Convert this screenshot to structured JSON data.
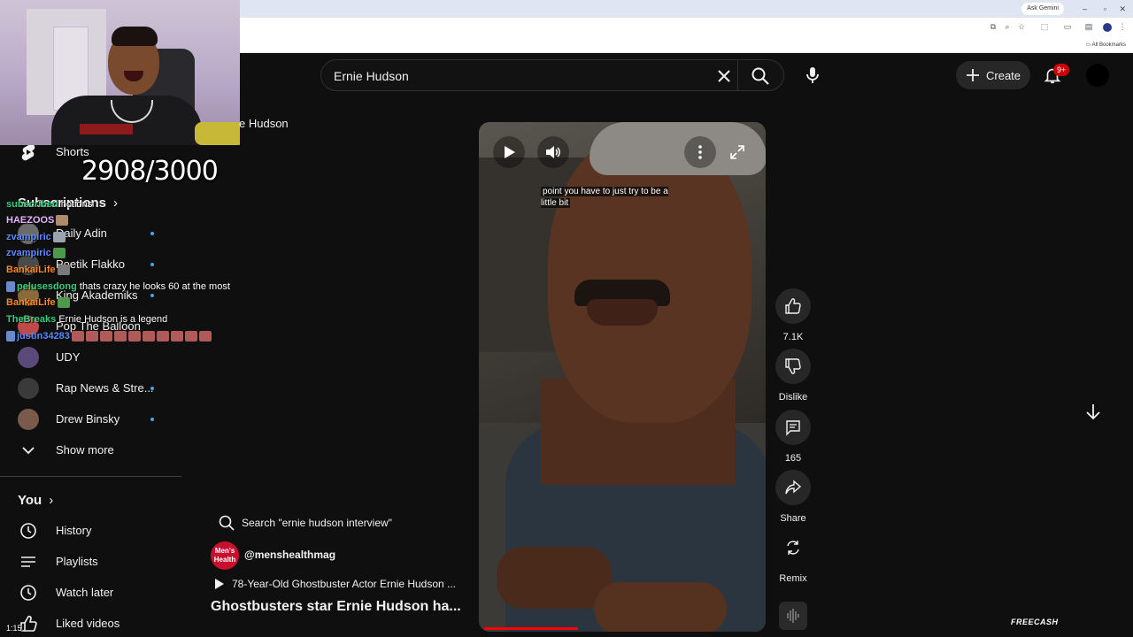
{
  "browser": {
    "gemini_label": "Ask Gemini",
    "bookmarks_label": "All Bookmarks"
  },
  "header": {
    "search_query": "Ernie Hudson",
    "create_label": "Create",
    "notification_count": "9+"
  },
  "overlay": {
    "counter": "2908/3000",
    "partial_title": "e Hudson"
  },
  "sidebar": {
    "shorts_label": "Shorts",
    "subscriptions_header": "Subscriptions",
    "subscriptions": [
      {
        "label": "Daily Adin",
        "color": "#6b6b6b"
      },
      {
        "label": "Poetik Flakko",
        "color": "#4a4a4a"
      },
      {
        "label": "King Akademiks",
        "color": "#8a6a3a"
      },
      {
        "label": "Pop The Balloon",
        "color": "#c04a4a"
      },
      {
        "label": "UDY",
        "color": "#5a4a7a"
      },
      {
        "label": "Rap News & Stre...",
        "color": "#3a3a3a"
      },
      {
        "label": "Drew Binsky",
        "color": "#7a5a4a"
      }
    ],
    "show_more_label": "Show more",
    "you_header": "You",
    "you_items": [
      {
        "label": "History",
        "icon": "history-icon"
      },
      {
        "label": "Playlists",
        "icon": "playlists-icon"
      },
      {
        "label": "Watch later",
        "icon": "watch-later-icon"
      },
      {
        "label": "Liked videos",
        "icon": "liked-videos-icon"
      }
    ]
  },
  "chat": [
    {
      "user": "subscribed",
      "user_color": "#35d07f",
      "msg": "notions"
    },
    {
      "user": "HAEZOOS",
      "user_color": "#e8b4ff",
      "msg": ""
    },
    {
      "user": "zvampiric",
      "user_color": "#5b8cff",
      "msg": ""
    },
    {
      "user": "zvampiric",
      "user_color": "#5b8cff",
      "msg": ""
    },
    {
      "user": "BankaiLife",
      "user_color": "#ff8a1f",
      "msg": ""
    },
    {
      "user": "pelusesdong",
      "user_color": "#35d07f",
      "msg": "thats crazy he looks 60 at the most"
    },
    {
      "user": "BankaiLife",
      "user_color": "#ff8a1f",
      "msg": ""
    },
    {
      "user": "TheBreaks",
      "user_color": "#35d07f",
      "msg": "Ernie Hudson is a legend"
    },
    {
      "user": "justin34283",
      "user_color": "#5b8cff",
      "msg": ""
    },
    {
      "user": "",
      "user_color": "#ffffff",
      "msg": "1:15"
    }
  ],
  "video": {
    "caption": "point you have to just try to be a little bit",
    "likes": "7.1K",
    "dislike_label": "Dislike",
    "comments": "165",
    "share_label": "Share",
    "remix_label": "Remix",
    "progress": 0.34
  },
  "meta": {
    "search_suggestion": "Search \"ernie hudson interview\"",
    "channel_handle": "@menshealthmag",
    "channel_avatar_text": "Men's Health",
    "related_video": "78-Year-Old Ghostbuster Actor Ernie Hudson ...",
    "title": "Ghostbusters star Ernie Hudson ha..."
  },
  "watermark": "FREECASH"
}
